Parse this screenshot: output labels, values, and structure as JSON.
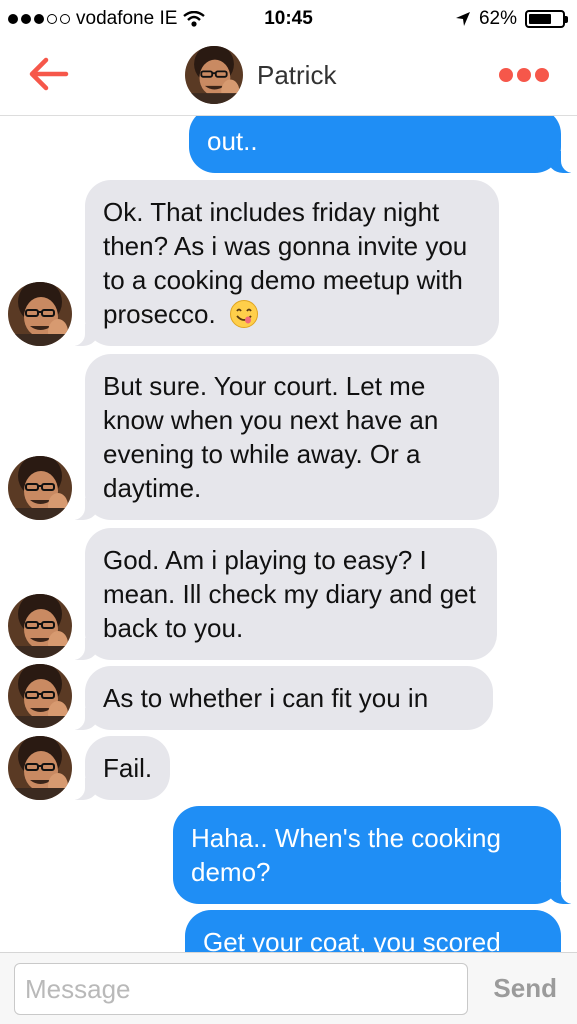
{
  "status_bar": {
    "carrier": "vodafone IE",
    "time": "10:45",
    "battery": "62%",
    "battery_level": 0.62,
    "signal_bars_filled": 3,
    "signal_bars_total": 5
  },
  "header": {
    "contact_name": "Patrick",
    "accent_color": "#f6574a"
  },
  "messages": [
    {
      "from": "me",
      "text": "out.."
    },
    {
      "from": "contact",
      "text": "Ok. That includes friday night then? As i was gonna invite you to a cooking demo meetup with prosecco.",
      "emoji": "yum-face"
    },
    {
      "from": "contact",
      "text": "But sure. Your court. Let me know when you next have an evening to while away. Or a daytime."
    },
    {
      "from": "contact",
      "text": "God. Am i playing to easy? I mean. Ill check my diary and get back to you."
    },
    {
      "from": "contact",
      "text": "As to whether i can fit you in"
    },
    {
      "from": "contact",
      "text": "Fail."
    },
    {
      "from": "me",
      "text": "Haha.. When's the cooking demo?"
    },
    {
      "from": "me",
      "text": "Get your coat, you scored"
    }
  ],
  "composer": {
    "placeholder": "Message",
    "send_label": "Send"
  },
  "colors": {
    "outgoing_bubble": "#1f8ef5",
    "incoming_bubble": "#e6e6eb"
  }
}
